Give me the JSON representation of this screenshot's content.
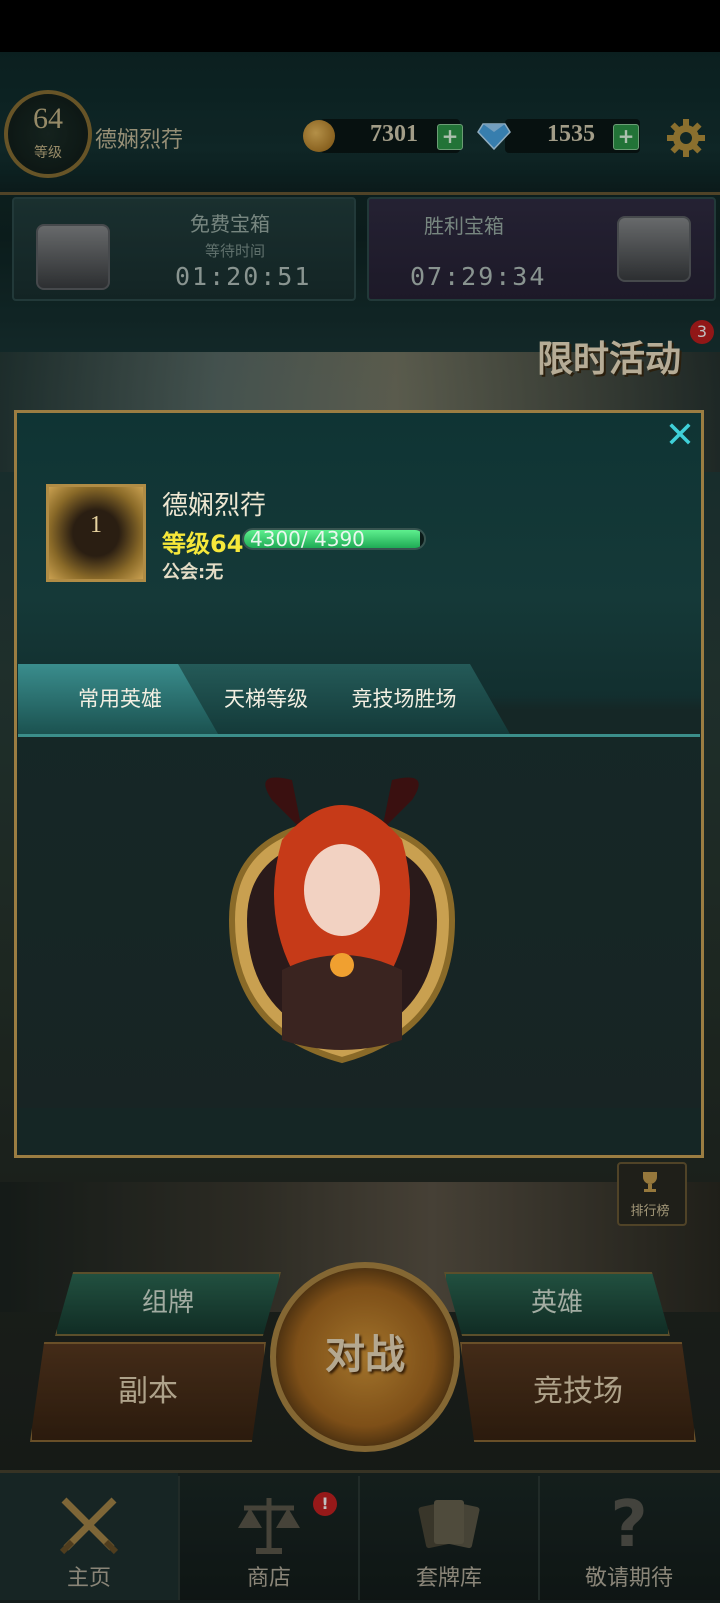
{
  "header": {
    "level": "64",
    "level_caption": "等级",
    "player_name": "德娴烈荇",
    "gold": "7301",
    "gems": "1535",
    "plus_symbol": "+"
  },
  "chests": {
    "free": {
      "title": "免费宝箱",
      "subtitle": "等待时间",
      "timer": "01:20:51"
    },
    "victory": {
      "title": "胜利宝箱",
      "timer": "07:29:34"
    }
  },
  "event": {
    "label": "限时活动",
    "badge_count": "3"
  },
  "profile_modal": {
    "close_symbol": "✕",
    "rank": "1",
    "name": "德娴烈荇",
    "level_label": "等级64",
    "xp_text": "4300/ 4390",
    "xp_fraction": 0.98,
    "guild_label": "公会:无",
    "tabs": [
      {
        "label": "常用英雄",
        "active": true
      },
      {
        "label": "天梯等级",
        "active": false
      },
      {
        "label": "竞技场胜场",
        "active": false
      }
    ]
  },
  "ranking": {
    "label": "排行榜"
  },
  "actions": {
    "deck": "组牌",
    "heroes": "英雄",
    "dungeon": "副本",
    "battle": "对战",
    "arena": "竞技场"
  },
  "bottom_nav": {
    "items": [
      {
        "label": "主页",
        "icon": "crossed-swords-icon",
        "active": true
      },
      {
        "label": "商店",
        "icon": "scales-icon",
        "badge": "!"
      },
      {
        "label": "套牌库",
        "icon": "cards-icon"
      },
      {
        "label": "敬请期待",
        "icon": "question-icon",
        "glyph": "?"
      }
    ]
  },
  "colors": {
    "accent_gold": "#b08c45",
    "xp_green": "#1faa55",
    "level_yellow": "#f6e83a",
    "close_cyan": "#3fd0d8",
    "badge_red": "#c21f1f"
  }
}
